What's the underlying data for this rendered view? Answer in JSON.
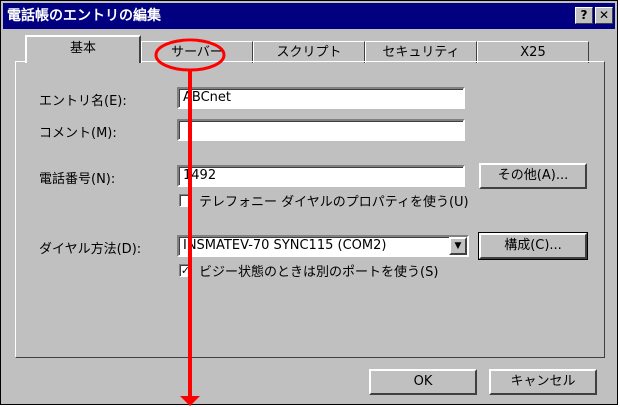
{
  "window": {
    "title": "電話帳のエントリの編集",
    "help_btn": "?",
    "close_btn": "✕"
  },
  "tabs": [
    {
      "label": "基本"
    },
    {
      "label": "サーバー"
    },
    {
      "label": "スクリプト"
    },
    {
      "label": "セキュリティ"
    },
    {
      "label": "X25"
    }
  ],
  "form": {
    "entry_name_label": "エントリ名(E):",
    "entry_name_value": "ABCnet",
    "comment_label": "コメント(M):",
    "comment_value": "",
    "phone_label": "電話番号(N):",
    "phone_value": "1492",
    "other_button": "その他(A)...",
    "telephony_checkbox_label": "テレフォニー ダイヤルのプロパティを使う(U)",
    "telephony_checked": false,
    "dial_method_label": "ダイヤル方法(D):",
    "dial_method_value": "INSMATEV-70 SYNC115 (COM2)",
    "config_button": "構成(C)...",
    "busy_checkbox_label": "ビジー状態のときは別のポートを使う(S)",
    "busy_checked": true
  },
  "footer": {
    "ok": "OK",
    "cancel": "キャンセル"
  },
  "annotation": {
    "color": "#ff0000"
  }
}
